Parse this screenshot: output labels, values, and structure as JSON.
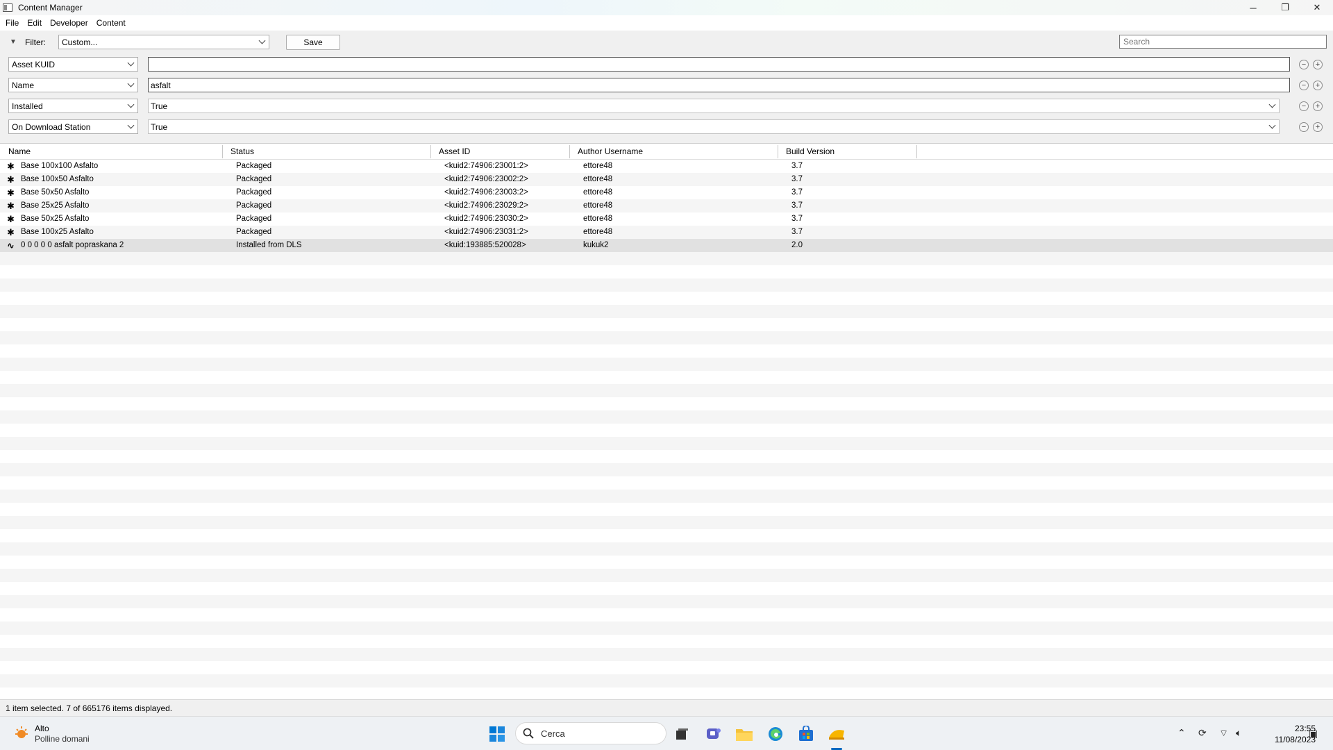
{
  "window": {
    "title": "Content Manager",
    "controls": {
      "minimize": "─",
      "restore": "❐",
      "close": "✕"
    }
  },
  "menu": [
    "File",
    "Edit",
    "Developer",
    "Content"
  ],
  "filter": {
    "label": "Filter:",
    "preset": "Custom...",
    "save_label": "Save",
    "search_placeholder": "Search",
    "rows": [
      {
        "field": "Asset KUID",
        "value": "",
        "kind": "input"
      },
      {
        "field": "Name",
        "value": "asfalt",
        "kind": "input"
      },
      {
        "field": "Installed",
        "value": "True",
        "kind": "select"
      },
      {
        "field": "On Download Station",
        "value": "True",
        "kind": "select"
      }
    ],
    "remove_symbol": "−",
    "add_symbol": "+"
  },
  "table": {
    "columns": [
      "Name",
      "Status",
      "Asset ID",
      "Author Username",
      "Build Version"
    ],
    "rows": [
      {
        "icon": "puzzle-icon",
        "name": "Base 100x100 Asfalto",
        "status": "Packaged",
        "asset_id": "<kuid2:74906:23001:2>",
        "author": "ettore48",
        "build": "3.7",
        "selected": false
      },
      {
        "icon": "puzzle-icon",
        "name": "Base 100x50 Asfalto",
        "status": "Packaged",
        "asset_id": "<kuid2:74906:23002:2>",
        "author": "ettore48",
        "build": "3.7",
        "selected": false
      },
      {
        "icon": "puzzle-icon",
        "name": "Base 50x50 Asfalto",
        "status": "Packaged",
        "asset_id": "<kuid2:74906:23003:2>",
        "author": "ettore48",
        "build": "3.7",
        "selected": false
      },
      {
        "icon": "puzzle-icon",
        "name": "Base 25x25 Asfalto",
        "status": "Packaged",
        "asset_id": "<kuid2:74906:23029:2>",
        "author": "ettore48",
        "build": "3.7",
        "selected": false
      },
      {
        "icon": "puzzle-icon",
        "name": "Base 50x25 Asfalto",
        "status": "Packaged",
        "asset_id": "<kuid2:74906:23030:2>",
        "author": "ettore48",
        "build": "3.7",
        "selected": false
      },
      {
        "icon": "puzzle-icon",
        "name": "Base 100x25 Asfalto",
        "status": "Packaged",
        "asset_id": "<kuid2:74906:23031:2>",
        "author": "ettore48",
        "build": "3.7",
        "selected": false
      },
      {
        "icon": "track-icon",
        "name": "0 0 0 0 0 asfalt popraskana 2",
        "status": "Installed from DLS",
        "asset_id": "<kuid:193885:520028>",
        "author": "kukuk2",
        "build": "2.0",
        "selected": true
      }
    ]
  },
  "status_bar": "1 item selected. 7 of 665176 items displayed.",
  "taskbar": {
    "weather_title": "Alto",
    "weather_subtitle": "Polline domani",
    "search_label": "Cerca",
    "time": "23:55",
    "date": "11/08/2023",
    "colors": {
      "accent": "#0067c0",
      "weather": "#f08a24"
    }
  }
}
